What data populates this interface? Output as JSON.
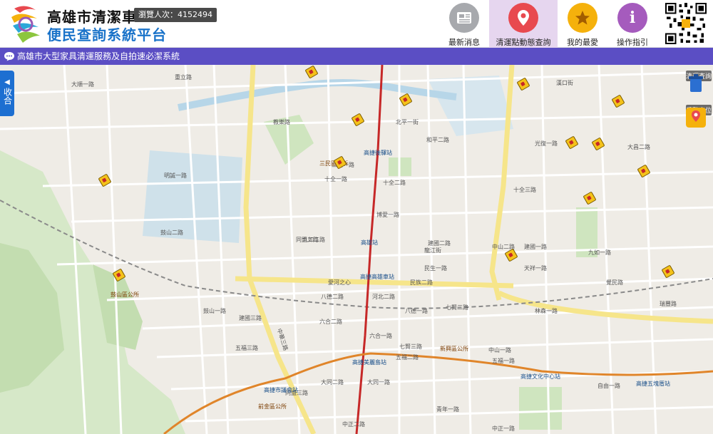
{
  "header": {
    "title": "高雄市清潔車",
    "subtitle": "便民查詢系統平台",
    "visit_label": "瀏覽人次：4152494"
  },
  "nav": [
    {
      "label": "最新消息",
      "icon": "newspaper-icon",
      "color": "#a7a9ad"
    },
    {
      "label": "清運點動態查詢",
      "icon": "map-pin-icon",
      "color": "#e8494f"
    },
    {
      "label": "我的最愛",
      "icon": "star-icon",
      "color": "#f5b10c"
    },
    {
      "label": "操作指引",
      "icon": "info-icon",
      "color": "#a55bbd"
    }
  ],
  "banner": {
    "text": "高雄市大型家具清運服務及自拍速必潔系統",
    "icon": "chat-bubble-icon"
  },
  "sidebar": {
    "collapse_label": "收合",
    "tools": [
      {
        "label": "清運查詢",
        "icon": "trash-can-icon"
      },
      {
        "label": "手動定位",
        "icon": "hand-pointer-location-icon"
      }
    ]
  },
  "map": {
    "roads": [
      "大順一路",
      "重立路",
      "教樂路",
      "和平二路",
      "民族二路",
      "十全一路",
      "十全二路",
      "十全三路",
      "九如二路",
      "九如一路",
      "建國一路",
      "建國二路",
      "建國三路",
      "中華三路",
      "中山一路",
      "中山二路",
      "七賢二路",
      "七賢三路",
      "六合一路",
      "六合二路",
      "五福一路",
      "五福二路",
      "五福三路",
      "大同一路",
      "大同二路",
      "青年一路",
      "中正一路",
      "中正二路",
      "八德一路",
      "八德二路",
      "河北二路",
      "自由一路",
      "民生一路",
      "博愛一路",
      "明誠一路",
      "鼓山二路",
      "鼓山一路",
      "同盟二路",
      "同盟三路",
      "北平一街",
      "愛河之心",
      "天祥一路",
      "光復一路",
      "林森一路",
      "瑞豐路",
      "三民一路",
      "漢口街",
      "大昌二路",
      "龍江街",
      "覺民路"
    ],
    "stations": [
      "高捷後驛站",
      "高雄站",
      "高捷高雄車站",
      "高捷美麗島站",
      "高捷市議會站",
      "高捷文化中心站",
      "高捷五塊厝站"
    ],
    "landmarks": [
      "三民區公所",
      "鼓山區公所",
      "前金區公所",
      "新興區公所"
    ]
  }
}
